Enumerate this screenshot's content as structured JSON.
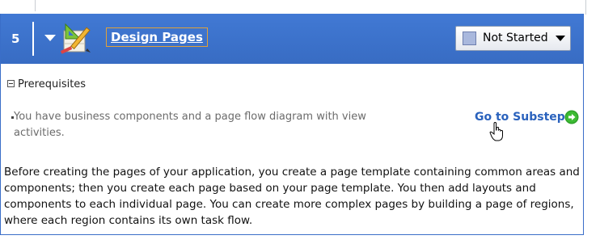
{
  "step": {
    "number": "5",
    "title": "Design Pages",
    "status": "Not Started"
  },
  "prerequisites": {
    "heading": "Prerequisites",
    "items": [
      "You have business components and a page flow diagram with view activities."
    ],
    "link_label": "Go to Substeps"
  },
  "description": "Before creating the pages of your application, you create a page template containing common areas and components; then you create each page based on your page template. You then add layouts and components to each individual page. You can create more complex pages by building a page of regions, where each region contains its own task flow.",
  "icons": {
    "collapse": "chevron-down-icon",
    "step": "design-tools-icon",
    "go": "green-arrow-circle-icon",
    "cursor": "hand-cursor-icon"
  },
  "colors": {
    "header": "#3c73cc",
    "link": "#2a62bd",
    "focus_border": "#e0a13a",
    "status_swatch": "#a9b8dd"
  }
}
